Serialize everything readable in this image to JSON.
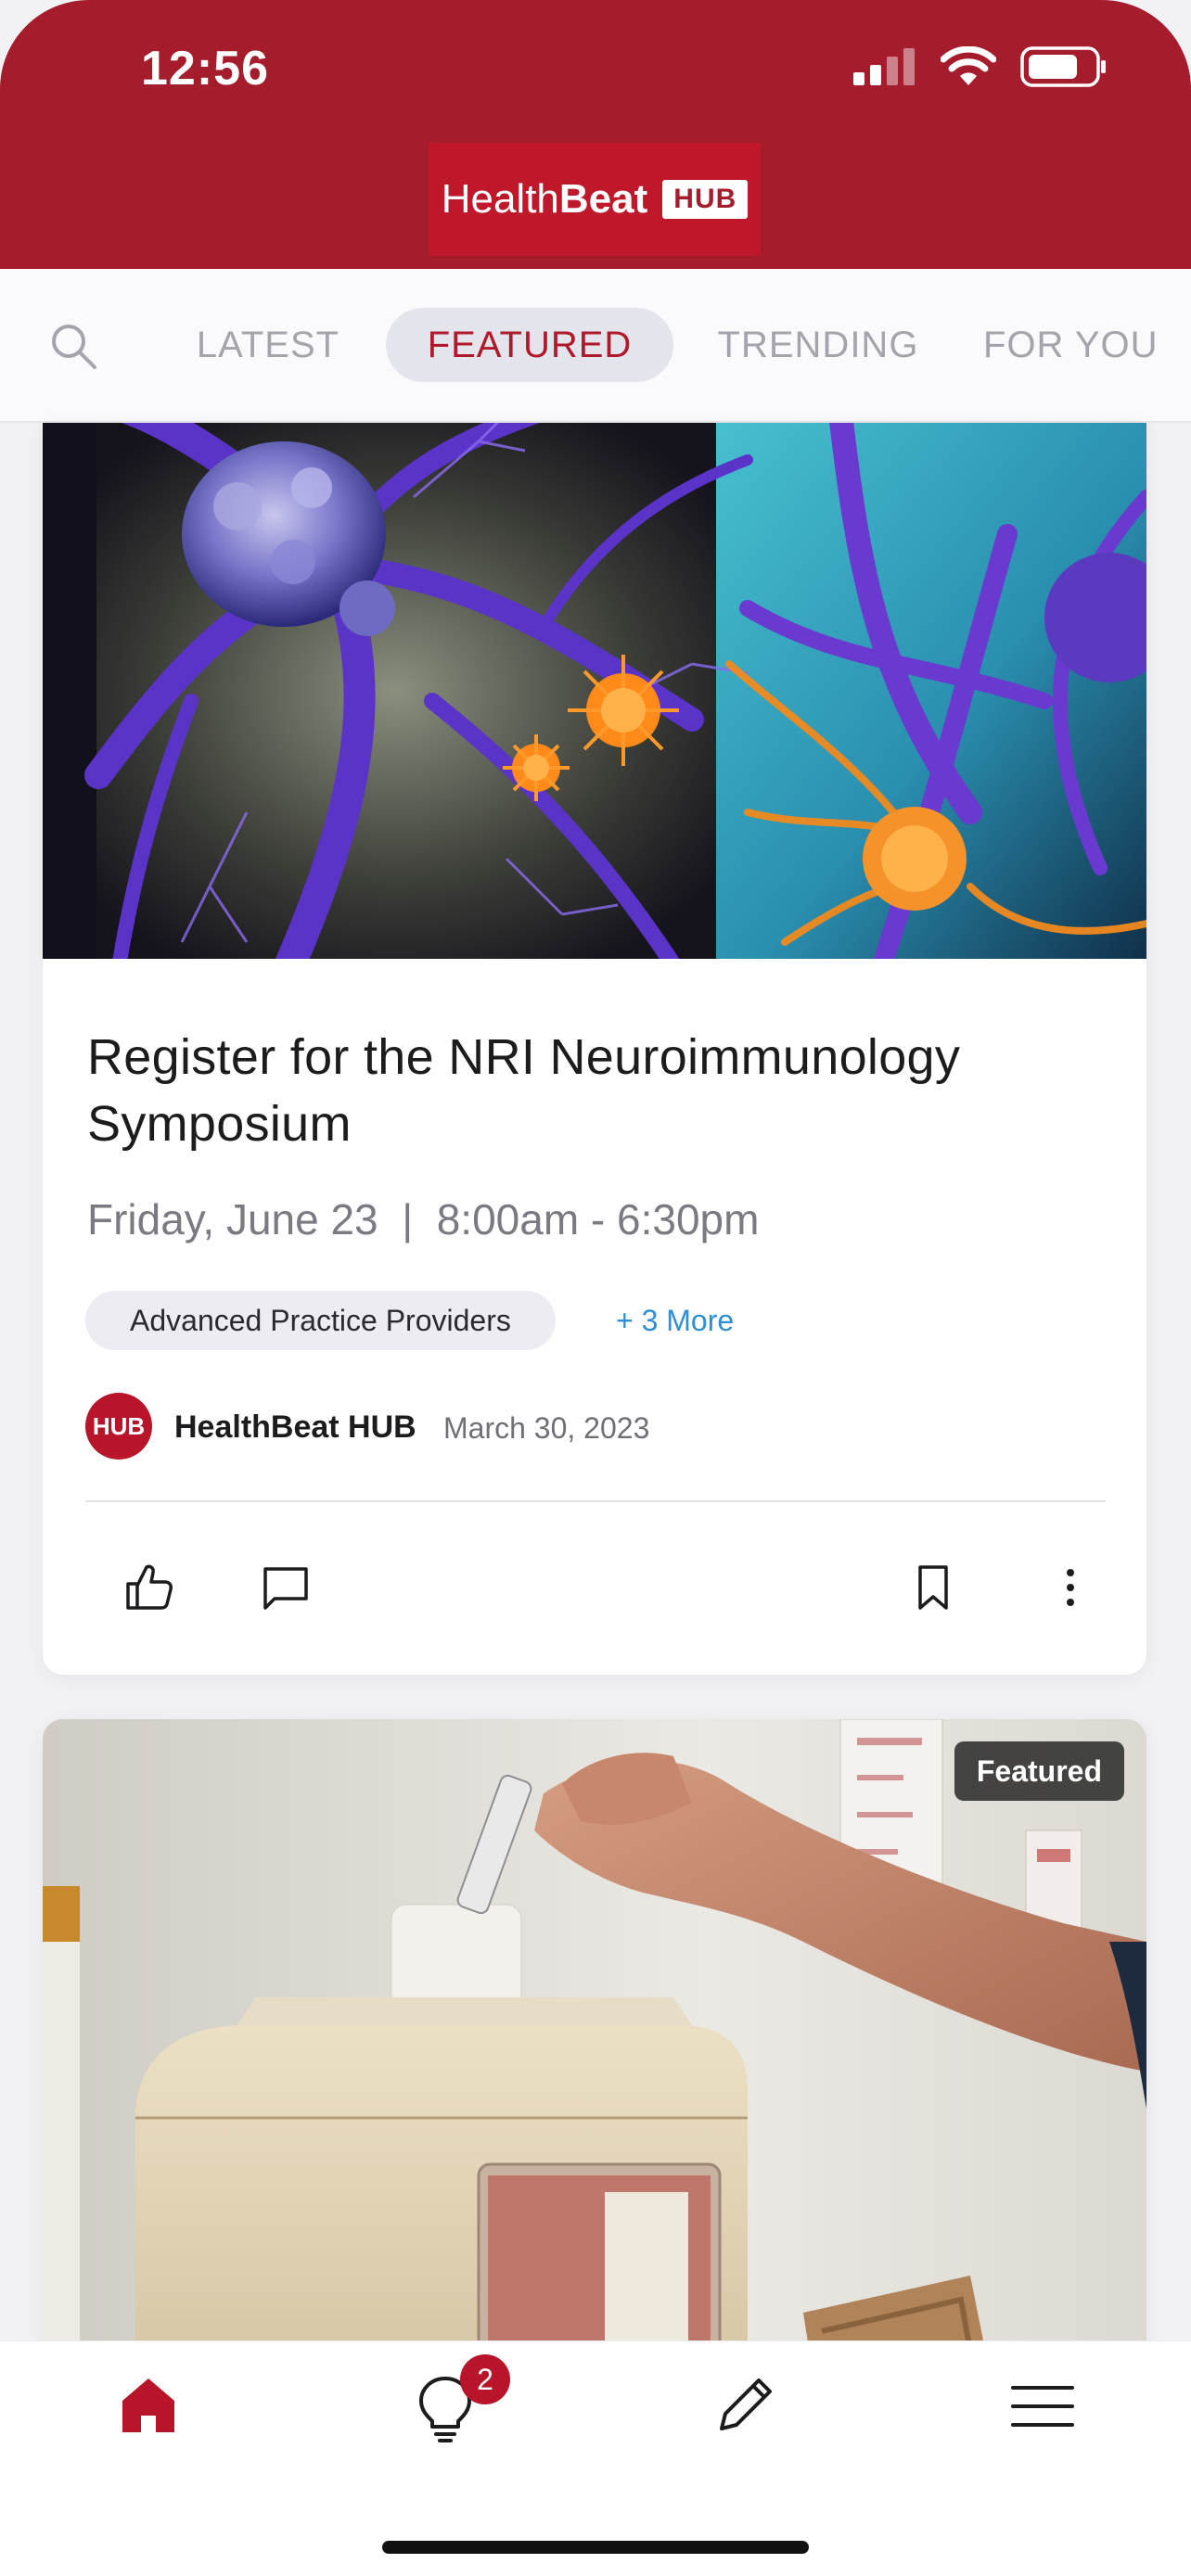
{
  "status_bar": {
    "time": "12:56"
  },
  "header": {
    "logo_text_light": "Health",
    "logo_text_bold": "Beat",
    "logo_badge": "HUB"
  },
  "tabs": [
    {
      "label": "LATEST",
      "active": false
    },
    {
      "label": "FEATURED",
      "active": true
    },
    {
      "label": "TRENDING",
      "active": false
    },
    {
      "label": "FOR YOU",
      "active": false
    }
  ],
  "cards": [
    {
      "image": "neuron-illustration",
      "title": "Register for the NRI Neuroimmunology Symposium",
      "when": "Friday, June 23  |  8:00am - 6:30pm",
      "tag": "Advanced Practice Providers",
      "more_tags": "+ 3 More",
      "author_avatar": "HUB",
      "author": "HealthBeat HUB",
      "date": "March 30, 2023",
      "actions": [
        "like-icon",
        "comment-icon",
        "bookmark-icon",
        "more-vertical-icon"
      ]
    },
    {
      "image": "sharps-container-photo",
      "badge": "Featured"
    }
  ],
  "bottom_nav": {
    "items": [
      "home-icon",
      "lightbulb-icon",
      "pencil-icon",
      "menu-icon"
    ],
    "notification_count": "2"
  },
  "colors": {
    "brand": "#a51d2d",
    "accent": "#b0182b",
    "link": "#2f8fd4"
  }
}
